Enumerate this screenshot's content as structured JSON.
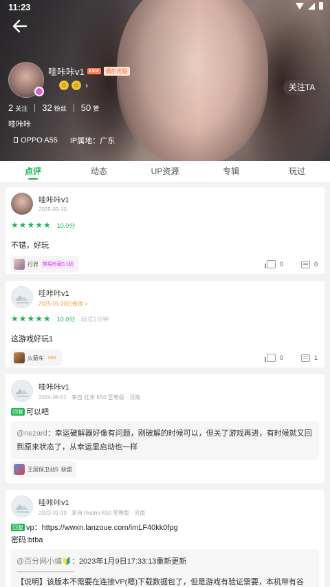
{
  "status_bar": {
    "time": "11:23"
  },
  "profile": {
    "username": "哇咔咔v1",
    "level": "LV.4",
    "level_title": "偶尔光临",
    "follow_label": "关注TA",
    "stats": [
      {
        "num": "2",
        "label": "关注"
      },
      {
        "num": "32",
        "label": "粉丝"
      },
      {
        "num": "50",
        "label": "赞"
      }
    ],
    "bio": "哇咔咔",
    "device": "OPPO A55",
    "ip_location": "IP属地：广东"
  },
  "tabs": [
    {
      "label": "点评",
      "active": true
    },
    {
      "label": "动态",
      "active": false
    },
    {
      "label": "UP资源",
      "active": false
    },
    {
      "label": "专辑",
      "active": false
    },
    {
      "label": "玩过",
      "active": false
    }
  ],
  "colors": {
    "accent": "#19b54e",
    "edited": "#f39c2a",
    "level_badge": "#ff7a50"
  },
  "feed": [
    {
      "name": "哇咔咔v1",
      "date": "2025-05-10",
      "stars": "★★★★★",
      "score": "10.0分",
      "played": "",
      "text": "不错，好玩",
      "game": "行界",
      "game_sub": "禁易秒藏0.1折",
      "likes": "0",
      "comments": "0"
    },
    {
      "name": "哇咔咔v1",
      "date": "2025-01-20已修改 >",
      "stars": "★★★★★",
      "score": "10.0分",
      "played": "玩过1分钟",
      "text": "这游戏好玩1",
      "game": "火箭车",
      "game_sub": "666",
      "likes": "0",
      "comments": "1"
    },
    {
      "name": "哇咔咔v1",
      "meta": "2024-08-01 · 来自 红米 K50 至尊版 · 河南",
      "reply_badge": "回复",
      "reply_text": "可以吧",
      "quote_name": "@nezard",
      "quote_text": "：幸运破解器好像有问题，刚破解的时候可以，但关了游戏再进，有时候就又回到原来状态了，从幸运里启动也一样",
      "game": "王国保卫战5: 联盟"
    },
    {
      "name": "哇咔咔v1",
      "meta": "2023-01-09 · 来自 Redmi K50 至尊版 · 河南",
      "reply_badge": "回复",
      "reply_text": "vp：https://wwxn.lanzoue.com/imLF40kk0fpg",
      "reply_text2": "密码:btba",
      "quote_name": "@百分网小编🔰",
      "quote_text": "：2023年1月9日17:33:13重新更新",
      "quote_divider": "--------------------------------------------------",
      "quote_text2": "【说明】该版本不需要在连接VP(嗯)下载数据包了，但是游戏有验证需要，本机带有谷"
    }
  ]
}
